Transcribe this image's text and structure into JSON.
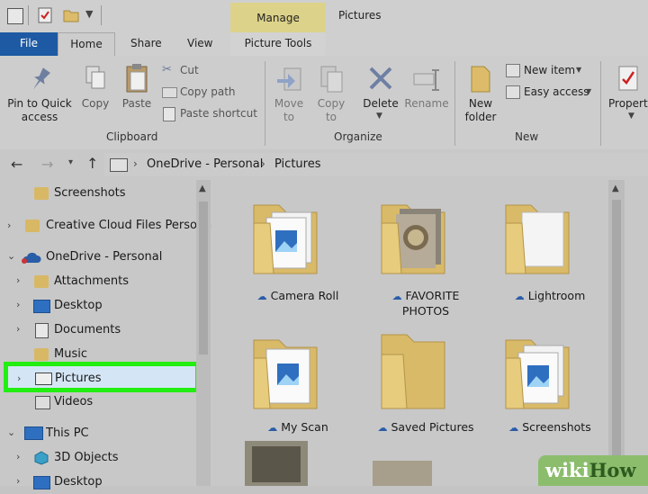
{
  "window": {
    "title": "Pictures",
    "context_tab_group": "Manage"
  },
  "tabs": [
    {
      "label": "File"
    },
    {
      "label": "Home"
    },
    {
      "label": "Share"
    },
    {
      "label": "View"
    },
    {
      "label": "Picture Tools"
    }
  ],
  "ribbon": {
    "clipboard": {
      "group_label": "Clipboard",
      "pin_label": "Pin to Quick access",
      "pin_label_l1": "Pin to Quick",
      "pin_label_l2": "access",
      "copy_label": "Copy",
      "paste_label": "Paste",
      "cut_label": "Cut",
      "copy_path_label": "Copy path",
      "paste_shortcut_label": "Paste shortcut"
    },
    "organize": {
      "group_label": "Organize",
      "move_to_l1": "Move",
      "move_to_l2": "to",
      "copy_to_l1": "Copy",
      "copy_to_l2": "to",
      "delete_label": "Delete",
      "rename_label": "Rename"
    },
    "new": {
      "group_label": "New",
      "new_folder_l1": "New",
      "new_folder_l2": "folder",
      "new_item_label": "New item",
      "easy_access_label": "Easy access"
    },
    "open": {
      "properties_label": "Propert"
    }
  },
  "address": {
    "segments": [
      "OneDrive - Personal",
      "Pictures"
    ]
  },
  "nav": {
    "items": [
      {
        "label": "Screenshots"
      },
      {
        "label": "Creative Cloud Files Persona"
      },
      {
        "label": "OneDrive - Personal"
      },
      {
        "label": "Attachments"
      },
      {
        "label": "Desktop"
      },
      {
        "label": "Documents"
      },
      {
        "label": "Music"
      },
      {
        "label": "Pictures"
      },
      {
        "label": "Videos"
      },
      {
        "label": "This PC"
      },
      {
        "label": "3D Objects"
      },
      {
        "label": "Desktop"
      }
    ],
    "highlight_color": "#22ee11"
  },
  "content": {
    "items": [
      {
        "label": "Camera Roll"
      },
      {
        "label_l1": "FAVORITE",
        "label_l2": "PHOTOS"
      },
      {
        "label": "Lightroom"
      },
      {
        "label": "My Scan"
      },
      {
        "label": "Saved Pictures"
      },
      {
        "label": "Screenshots"
      }
    ]
  },
  "watermark": {
    "text_a": "wiki",
    "text_b": "How"
  },
  "colors": {
    "file_tab": "#1e5aa3",
    "manage_tab": "#ddd28a",
    "folder": "#dcbc6a",
    "cloud": "#2a5da8"
  }
}
